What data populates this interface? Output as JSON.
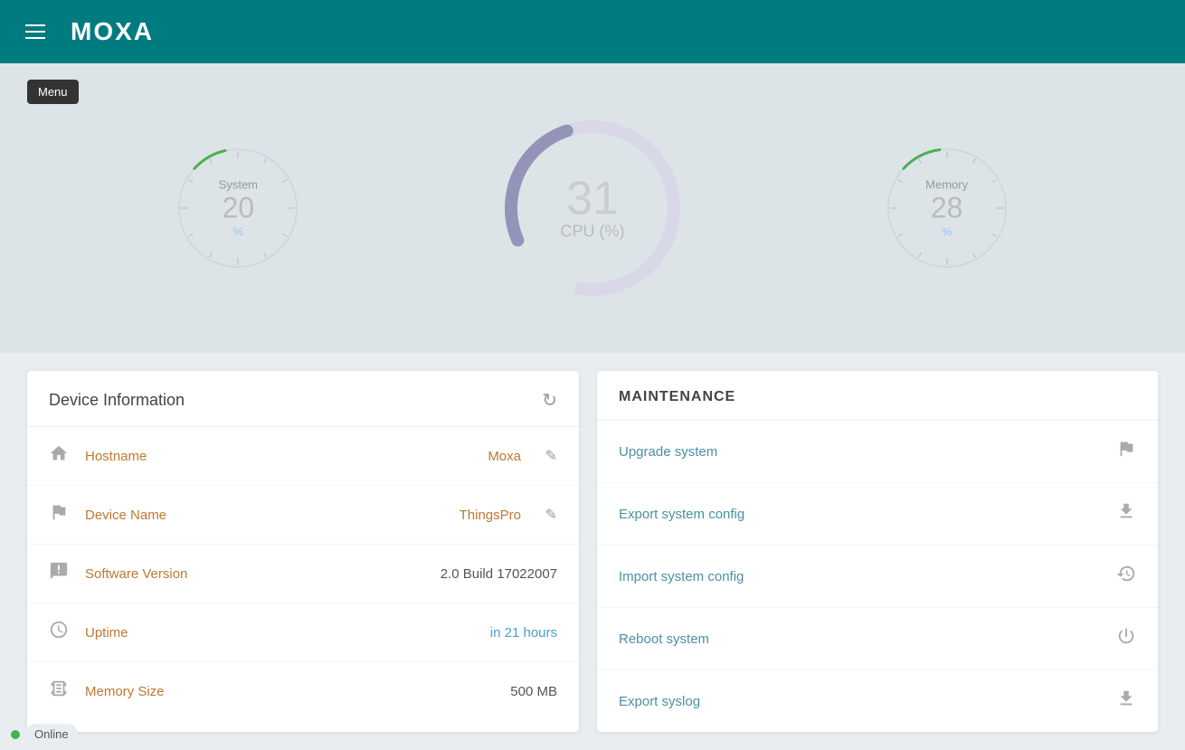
{
  "header": {
    "logo": "MOXA",
    "menu_label": "Menu",
    "hamburger_label": "hamburger-menu"
  },
  "gauges": {
    "system": {
      "title": "System",
      "value": "20",
      "unit": "%",
      "percent": 20,
      "color": "#4caf50"
    },
    "cpu": {
      "value": "31",
      "label": "CPU (%)",
      "percent": 31,
      "color": "#9e9ec8"
    },
    "memory": {
      "title": "Memory",
      "value": "28",
      "unit": "%",
      "percent": 28,
      "color": "#4caf50"
    }
  },
  "device_information": {
    "title": "Device Information",
    "refresh_icon": "↻",
    "rows": [
      {
        "icon": "🏠",
        "label": "Hostname",
        "value": "Moxa",
        "editable": true,
        "value_color": "orange"
      },
      {
        "icon": "🚩",
        "label": "Device Name",
        "value": "ThingsPro",
        "editable": true,
        "value_color": "orange"
      },
      {
        "icon": "❗",
        "label": "Software Version",
        "value": "2.0 Build 17022007",
        "editable": false,
        "value_color": "plain"
      },
      {
        "icon": "🕐",
        "label": "Uptime",
        "value": "in 21 hours",
        "editable": false,
        "value_color": "blue"
      },
      {
        "icon": "💾",
        "label": "Memory Size",
        "value": "500 MB",
        "editable": false,
        "value_color": "plain"
      }
    ]
  },
  "maintenance": {
    "title": "MAINTENANCE",
    "items": [
      {
        "label": "Upgrade system",
        "icon": "🚩"
      },
      {
        "label": "Export system config",
        "icon": "⬇"
      },
      {
        "label": "Import system config",
        "icon": "↻"
      },
      {
        "label": "Reboot system",
        "icon": "⏻"
      },
      {
        "label": "Export syslog",
        "icon": "⬇"
      }
    ]
  },
  "status": {
    "dot_color": "#4caf50",
    "label": "Online"
  }
}
